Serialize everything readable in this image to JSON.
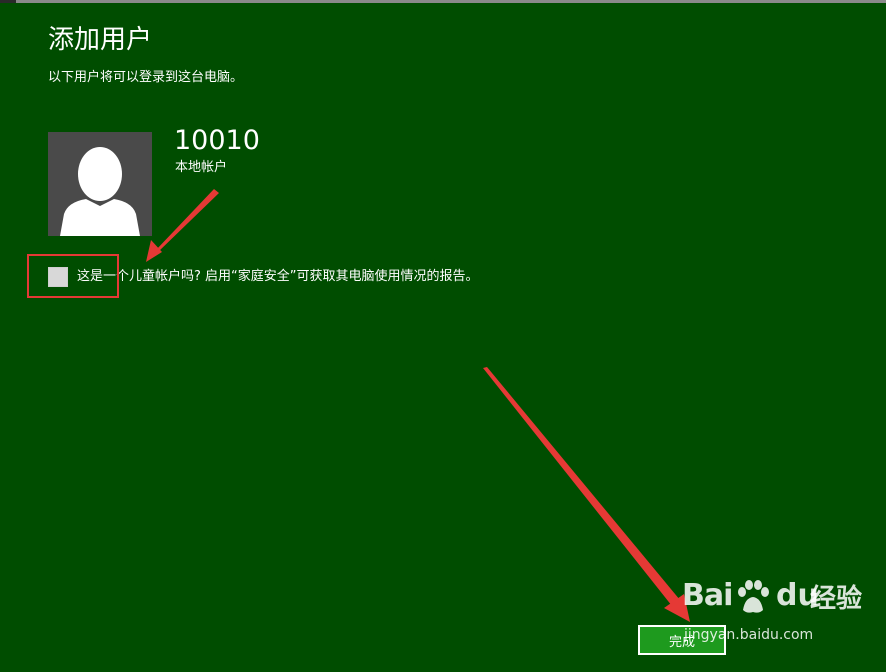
{
  "header": {
    "title": "添加用户",
    "subtitle": "以下用户将可以登录到这台电脑。"
  },
  "user": {
    "name": "10010",
    "account_type": "本地帐户",
    "avatar_icon": "user-silhouette-icon"
  },
  "child_account": {
    "checked": false,
    "label": "这是一个儿童帐户吗? 启用“家庭安全”可获取其电脑使用情况的报告。"
  },
  "footer": {
    "finish_label": "完成"
  },
  "annotation": {
    "highlight_color": "#e53935"
  },
  "watermark": {
    "brand_left": "Bai",
    "brand_right": "du",
    "product": "经验",
    "url": "jingyan.baidu.com"
  },
  "colors": {
    "background": "#004d00",
    "button": "#1e9a1e",
    "avatar_bg": "#4a4a4a"
  }
}
